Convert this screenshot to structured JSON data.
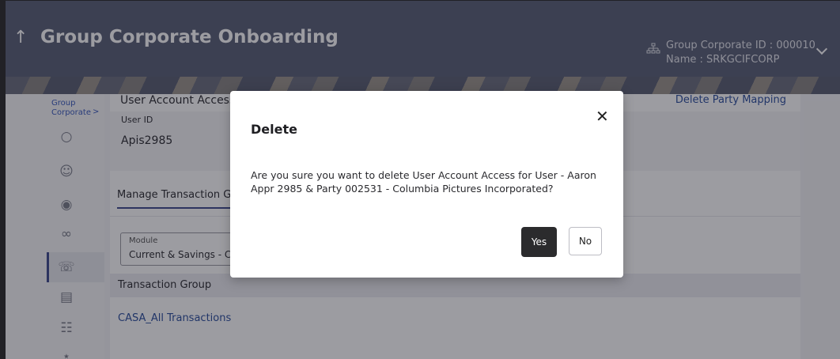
{
  "header": {
    "title": "Group Corporate Onboarding",
    "corporate_id": "Group Corporate ID : 000010",
    "corporate_name": "Name : SRKGCIFCORP"
  },
  "sidebar": {
    "breadcrumb_line1": "Group",
    "breadcrumb_line2": "Corporate",
    "items": [
      "globe-icon",
      "users-globe-icon",
      "user-badge-icon",
      "group-icon",
      "support-icon",
      "document-icon",
      "hierarchy-icon",
      "team-icon"
    ]
  },
  "main": {
    "section_title": "User Account Access",
    "delete_mapping_link": "Delete Party Mapping",
    "user_id_label": "User ID",
    "user_id_value": "Apis2985",
    "tab_label": "Manage Transaction Gro",
    "module_label": "Module",
    "module_value": "Current & Savings - Cor",
    "transaction_group_header": "Transaction Group",
    "transaction_group_row": "CASA_All Transactions"
  },
  "dialog": {
    "title": "Delete",
    "message": "Are you sure you want to delete User Account Access for User - Aaron Appr 2985 & Party 002531 - Columbia Pictures Incorporated?",
    "yes_label": "Yes",
    "no_label": "No"
  },
  "colors": {
    "header_bg": "#5b6178",
    "accent": "#3f4a8e",
    "link": "#2c4f9e",
    "primary_button": "#2b2b2d"
  }
}
